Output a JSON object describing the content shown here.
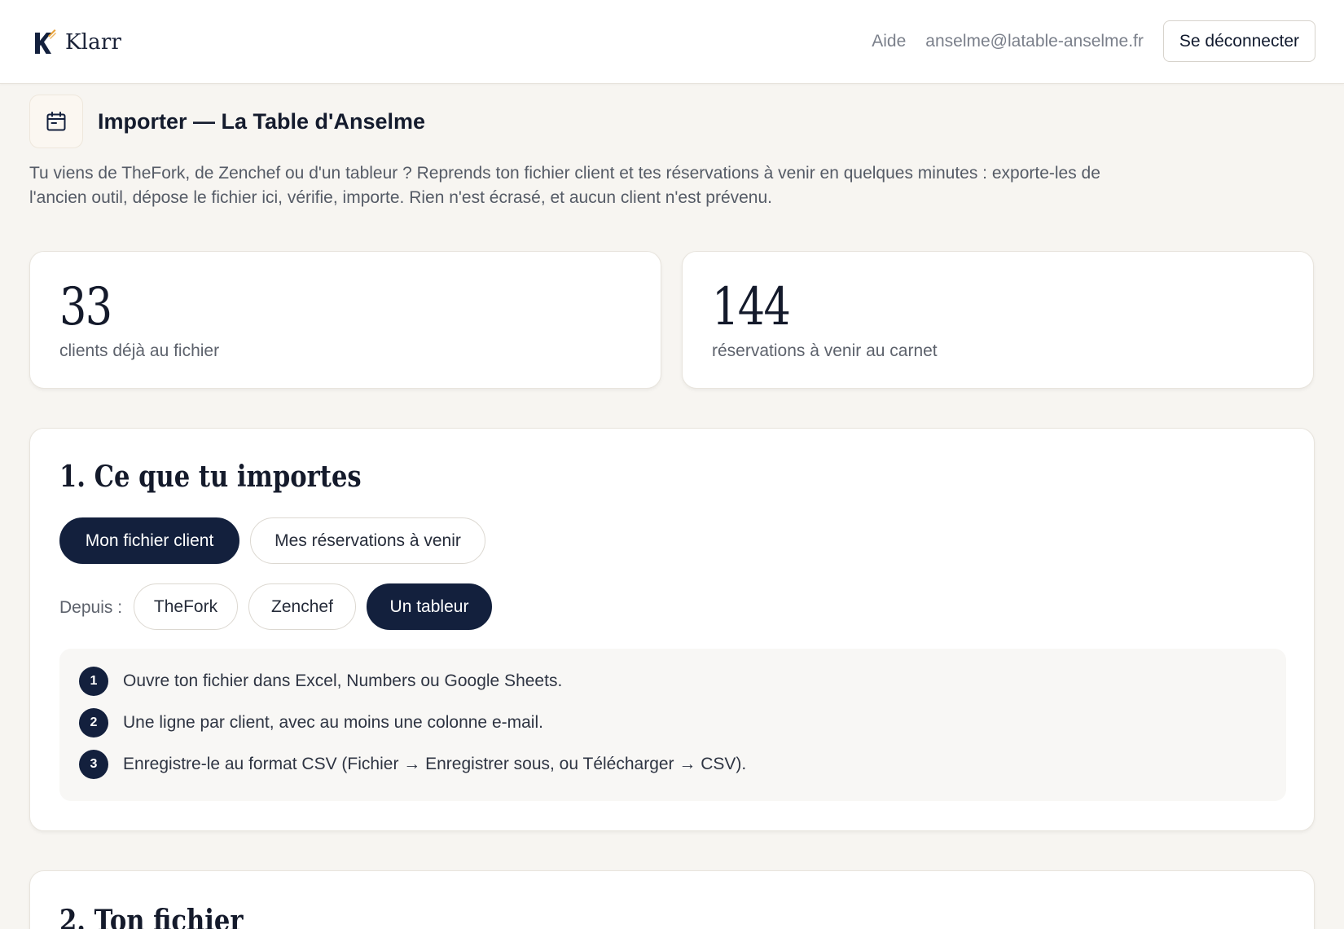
{
  "header": {
    "brand_name": "Klarr",
    "help_label": "Aide",
    "user_email": "anselme@latable-anselme.fr",
    "logout_label": "Se déconnecter",
    "brand_colors": {
      "navy": "#13203d",
      "gold": "#e8a23a"
    }
  },
  "page": {
    "title": "Importer — La Table d'Anselme",
    "title_icon": "calendar-icon",
    "intro": "Tu viens de TheFork, de Zenchef ou d'un tableur ? Reprends ton fichier client et tes réservations à venir en quelques minutes : exporte-les de l'ancien outil, dépose le fichier ici, vérifie, importe. Rien n'est écrasé, et aucun client n'est prévenu."
  },
  "stats": [
    {
      "value": "33",
      "label": "clients déjà au fichier"
    },
    {
      "value": "144",
      "label": "réservations à venir au carnet"
    }
  ],
  "section1": {
    "title": "1. Ce que tu importes",
    "import_types": [
      {
        "label": "Mon fichier client",
        "active": true
      },
      {
        "label": "Mes réservations à venir",
        "active": false
      }
    ],
    "source_label": "Depuis :",
    "sources": [
      {
        "label": "TheFork",
        "active": false
      },
      {
        "label": "Zenchef",
        "active": false
      },
      {
        "label": "Un tableur",
        "active": true
      }
    ],
    "steps": [
      {
        "num": "1",
        "text": "Ouvre ton fichier dans Excel, Numbers ou Google Sheets."
      },
      {
        "num": "2",
        "text": "Une ligne par client, avec au moins une colonne e-mail."
      },
      {
        "num": "3",
        "text": "Enregistre-le au format CSV (Fichier → Enregistrer sous, ou Télécharger → CSV)."
      }
    ]
  },
  "section2": {
    "title": "2. Ton fichier"
  }
}
